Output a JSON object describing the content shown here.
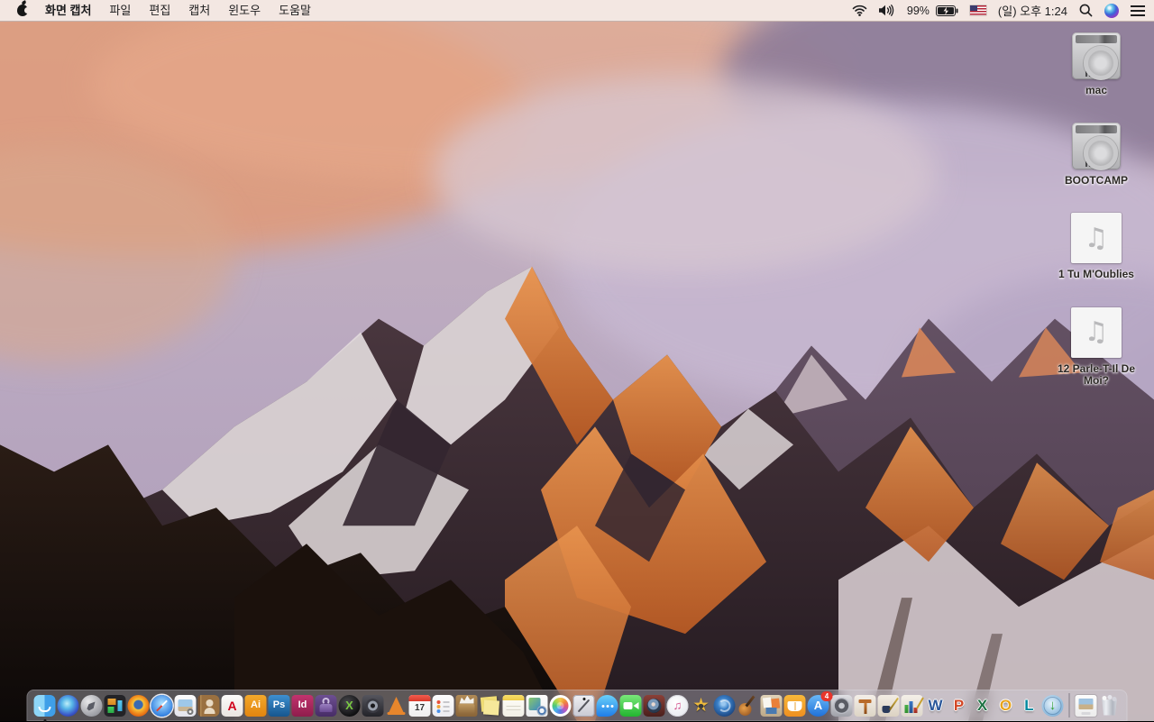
{
  "menu_bar": {
    "app_menus": [
      {
        "name": "app",
        "label": "화면 캡처",
        "classes": "active"
      },
      {
        "name": "file",
        "label": "파일"
      },
      {
        "name": "edit",
        "label": "편집"
      },
      {
        "name": "capture",
        "label": "캡처"
      },
      {
        "name": "window",
        "label": "윈도우"
      },
      {
        "name": "help",
        "label": "도움말"
      }
    ],
    "status": {
      "battery_percent": "99%",
      "clock": "(일) 오후 1:24",
      "input_source": "U.S. flag"
    }
  },
  "desktop": {
    "icons": [
      {
        "name": "mac",
        "label": "mac",
        "classes": "drive"
      },
      {
        "name": "bootcamp",
        "label": "BOOTCAMP",
        "classes": "drive"
      },
      {
        "name": "tu-moublies",
        "label": "1 Tu M'Oublies",
        "classes": "audio"
      },
      {
        "name": "parle-t-il-de-moi",
        "label": "12 Parle-T-Il De Moi?",
        "classes": "audio"
      }
    ]
  },
  "dock": {
    "items": [
      {
        "name": "finder",
        "classes": "run"
      },
      {
        "name": "siri"
      },
      {
        "name": "launchpad"
      },
      {
        "name": "mission-control"
      },
      {
        "name": "firefox"
      },
      {
        "name": "safari"
      },
      {
        "name": "preview"
      },
      {
        "name": "contacts"
      },
      {
        "name": "acrobat",
        "glyph": "A"
      },
      {
        "name": "illustrator",
        "glyph": "Ai"
      },
      {
        "name": "photoshop",
        "glyph": "Ps"
      },
      {
        "name": "indesign",
        "glyph": "Id"
      },
      {
        "name": "toast"
      },
      {
        "name": "xld",
        "glyph": "X"
      },
      {
        "name": "disc-app"
      },
      {
        "name": "vlc"
      },
      {
        "name": "calendar",
        "glyph": "17"
      },
      {
        "name": "reminders"
      },
      {
        "name": "unarchiver"
      },
      {
        "name": "stickies"
      },
      {
        "name": "notes"
      },
      {
        "name": "document-seal"
      },
      {
        "name": "photos"
      },
      {
        "name": "grab",
        "classes": "run"
      },
      {
        "name": "messages"
      },
      {
        "name": "facetime"
      },
      {
        "name": "photo-booth"
      },
      {
        "name": "itunes",
        "glyph": "♫"
      },
      {
        "name": "imovie",
        "glyph": "★"
      },
      {
        "name": "dvd-player"
      },
      {
        "name": "garageband"
      },
      {
        "name": "collage"
      },
      {
        "name": "ibooks"
      },
      {
        "name": "app-store",
        "glyph": "A",
        "badge": "4"
      },
      {
        "name": "system-preferences"
      },
      {
        "name": "keynote"
      },
      {
        "name": "pages"
      },
      {
        "name": "numbers"
      },
      {
        "name": "word",
        "glyph": "W"
      },
      {
        "name": "powerpoint",
        "glyph": "P"
      },
      {
        "name": "excel",
        "glyph": "X"
      },
      {
        "name": "outlook",
        "glyph": "O"
      },
      {
        "name": "lync",
        "glyph": "L"
      },
      {
        "name": "downloader",
        "glyph": "↓"
      }
    ],
    "right_items": [
      {
        "name": "jpg-document"
      },
      {
        "name": "trash"
      }
    ]
  },
  "colors": {
    "menubar_bg": "#f3e7e2",
    "menubar_text": "#1d1d1f",
    "dock_bg": "rgba(205,205,215,0.38)",
    "badge_red": "#e8352b",
    "label_text": "#2b2724",
    "sky_top": "#cbb6bd",
    "cloud_orange": "#e09a78",
    "cloud_lavender": "#c6b7d0",
    "rock_sunlit": "#d97a3e",
    "snow": "#e2dadc",
    "foreground_rock": "#140d0a"
  }
}
